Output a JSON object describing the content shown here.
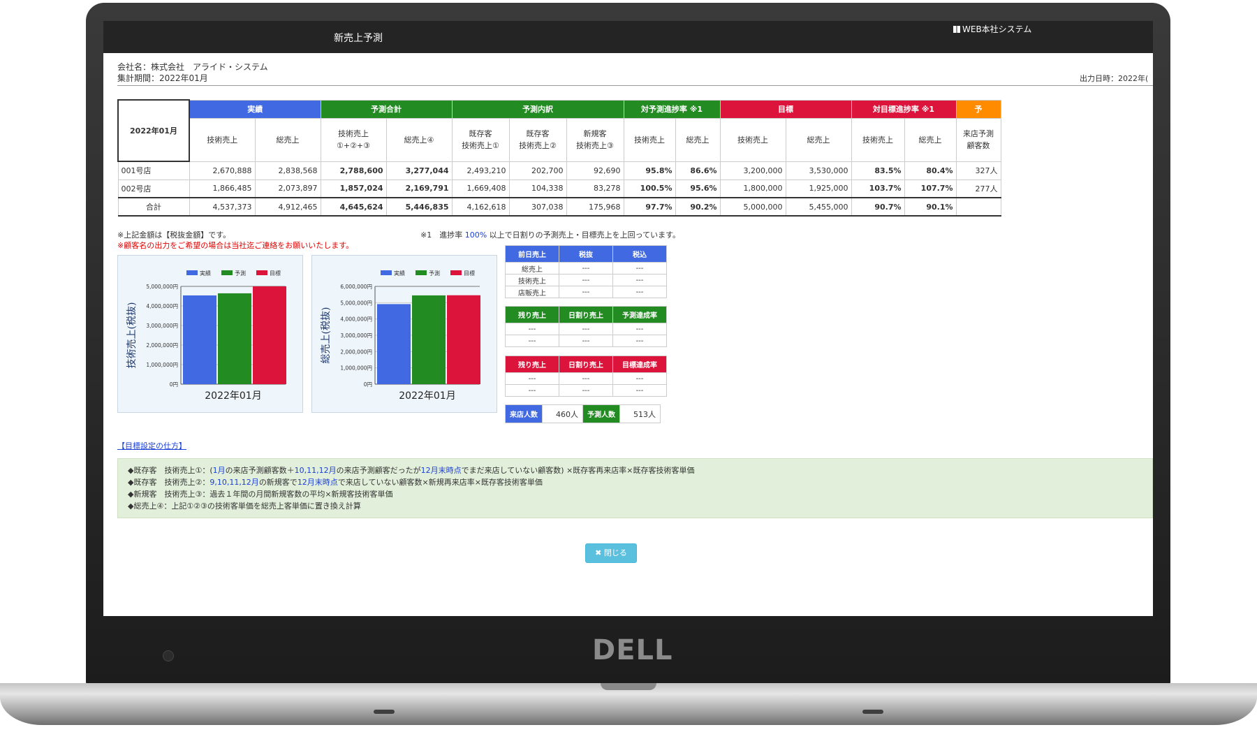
{
  "window": {
    "title": "新売上予測",
    "brand": "WEB本社システム"
  },
  "info": {
    "company": "会社名：株式会社　アライド・システム",
    "period": "集計期間：2022年01月",
    "output_date": "出力日時：2022年("
  },
  "main_table": {
    "corner": "2022年01月",
    "groups": [
      {
        "label": "実績",
        "color": "#4169e1"
      },
      {
        "label": "予測合計",
        "color": "#228b22"
      },
      {
        "label": "予測内訳",
        "color": "#228b22"
      },
      {
        "label": "対予測進捗率 ※1",
        "color": "#228b22"
      },
      {
        "label": "目標",
        "color": "#dc143c"
      },
      {
        "label": "対目標進捗率 ※1",
        "color": "#dc143c"
      },
      {
        "label": "予",
        "color": "#ff8c00"
      }
    ],
    "subheaders": [
      [
        "技術売上",
        ""
      ],
      [
        "総売上",
        ""
      ],
      [
        "技術売上",
        "①+②+③"
      ],
      [
        "総売上④",
        ""
      ],
      [
        "既存客",
        "技術売上①"
      ],
      [
        "既存客",
        "技術売上②"
      ],
      [
        "新規客",
        "技術売上③"
      ],
      [
        "技術売上",
        ""
      ],
      [
        "総売上",
        ""
      ],
      [
        "技術売上",
        ""
      ],
      [
        "総売上",
        ""
      ],
      [
        "技術売上",
        ""
      ],
      [
        "総売上",
        ""
      ],
      [
        "来店予測",
        "顧客数"
      ]
    ],
    "rows": [
      {
        "name": "001号店",
        "cells": [
          "2,670,888",
          "2,838,568",
          "2,788,600",
          "3,277,044",
          "2,493,210",
          "202,700",
          "92,690",
          "95.8%",
          "86.6%",
          "3,200,000",
          "3,530,000",
          "83.5%",
          "80.4%",
          "327人"
        ]
      },
      {
        "name": "002号店",
        "cells": [
          "1,866,485",
          "2,073,897",
          "1,857,024",
          "2,169,791",
          "1,669,408",
          "104,338",
          "83,278",
          "100.5%",
          "95.6%",
          "1,800,000",
          "1,925,000",
          "103.7%",
          "107.7%",
          "277人"
        ]
      },
      {
        "name": "合計",
        "cells": [
          "4,537,373",
          "4,912,465",
          "4,645,624",
          "5,446,835",
          "4,162,618",
          "307,038",
          "175,968",
          "97.7%",
          "90.2%",
          "5,000,000",
          "5,455,000",
          "90.7%",
          "90.1%",
          ""
        ]
      }
    ]
  },
  "notes": {
    "tax": "※上記金額は【税抜金額】です。",
    "customer": "※顧客名の出力をご希望の場合は当社迄ご連絡をお願いいたします。",
    "progress_pre": "※1　進捗率 ",
    "progress_pct": "100%",
    "progress_post": " 以上で日割りの予測売上・目標売上を上回っています。"
  },
  "colors": {
    "actual": "#4169e1",
    "forecast": "#228b22",
    "target": "#dc143c",
    "close_button": "#5bc0de"
  },
  "chart_data": [
    {
      "type": "bar",
      "categories": [
        "2022年01月"
      ],
      "series": [
        {
          "name": "実績",
          "values": [
            4537373
          ]
        },
        {
          "name": "予測",
          "values": [
            4645624
          ]
        },
        {
          "name": "目標",
          "values": [
            5000000
          ]
        }
      ],
      "ylabel": "技術売上(税抜)",
      "yticks": [
        "0円",
        "1,000,000円",
        "2,000,000円",
        "3,000,000円",
        "4,000,000円",
        "5,000,000円"
      ],
      "ylim": [
        0,
        5000000
      ],
      "legend": "top"
    },
    {
      "type": "bar",
      "categories": [
        "2022年01月"
      ],
      "series": [
        {
          "name": "実績",
          "values": [
            4912465
          ]
        },
        {
          "name": "予測",
          "values": [
            5446835
          ]
        },
        {
          "name": "目標",
          "values": [
            5455000
          ]
        }
      ],
      "ylabel": "総売上(税抜)",
      "yticks": [
        "0円",
        "1,000,000円",
        "2,000,000円",
        "3,000,000円",
        "4,000,000円",
        "5,000,000円",
        "6,000,000円"
      ],
      "ylim": [
        0,
        6000000
      ],
      "legend": "top"
    }
  ],
  "prev_day_table": {
    "headers": [
      "前日売上",
      "税抜",
      "税込"
    ],
    "rows": [
      [
        "総売上",
        "---",
        "---"
      ],
      [
        "技術売上",
        "---",
        "---"
      ],
      [
        "店販売上",
        "---",
        "---"
      ]
    ]
  },
  "forecast_remaining_table": {
    "headers": [
      "残り売上",
      "日割り売上",
      "予測達成率"
    ],
    "rows": [
      [
        "---",
        "---",
        "---"
      ],
      [
        "---",
        "---",
        "---"
      ]
    ]
  },
  "target_remaining_table": {
    "headers": [
      "残り売上",
      "日割り売上",
      "目標達成率"
    ],
    "rows": [
      [
        "---",
        "---",
        "---"
      ],
      [
        "---",
        "---",
        "---"
      ]
    ]
  },
  "visitors": {
    "visit_label": "来店人数",
    "visit_value": "460人",
    "forecast_label": "予測人数",
    "forecast_value": "513人"
  },
  "target_link": "【目標設定の仕方】",
  "formulas": [
    [
      "◆既存客　技術売上①：(",
      "1月",
      "の来店予測顧客数＋",
      "10,11,12月",
      "の来店予測顧客だったが",
      "12月末時点",
      "でまだ来店していない顧客数) ×既存客再来店率×既存客技術客単価"
    ],
    [
      "◆既存客　技術売上②：",
      "9,10,11,12月",
      "の新規客で",
      "12月末時点",
      "で来店していない顧客数×新規再来店率×既存客技術客単価"
    ],
    [
      "◆新規客　技術売上③：過去１年間の月間新規客数の平均×新規客技術客単価"
    ],
    [
      "◆総売上④：上記①②③の技術客単価を総売上客単価に置き換え計算"
    ]
  ],
  "close_button": "✖ 閉じる"
}
